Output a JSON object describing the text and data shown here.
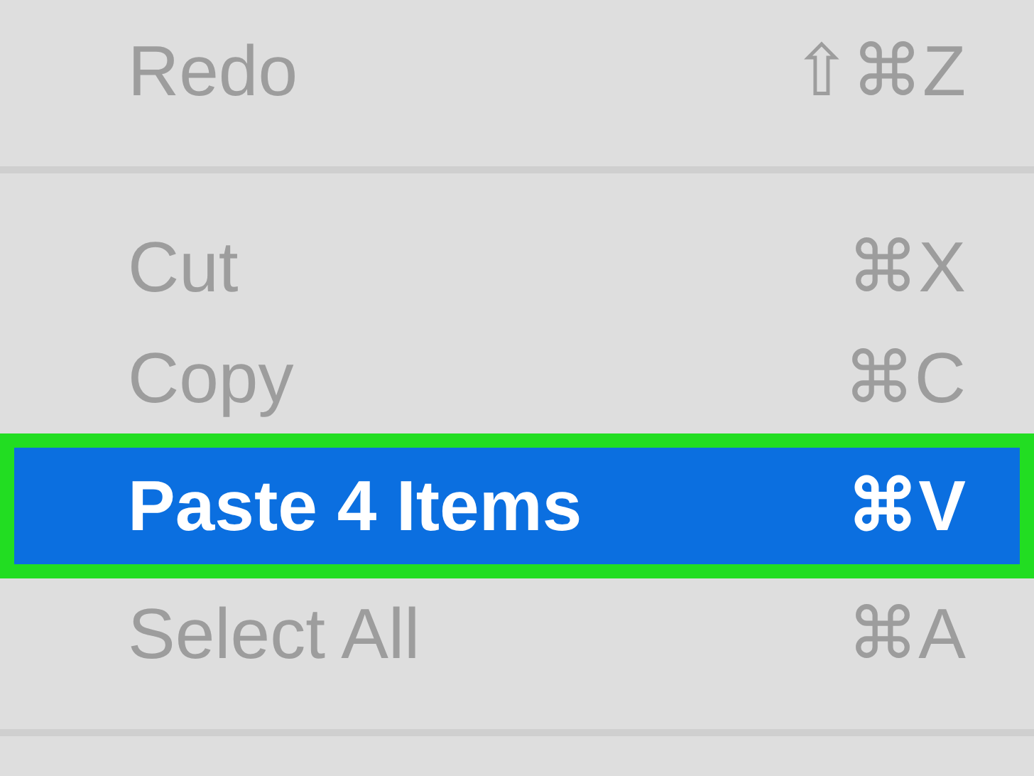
{
  "menu": {
    "items": [
      {
        "kind": "item",
        "label": "Redo",
        "shortcut": "⇧⌘Z",
        "disabled": true,
        "selected": false,
        "annotated": false
      },
      {
        "kind": "separator"
      },
      {
        "kind": "item",
        "label": "Cut",
        "shortcut": "⌘X",
        "disabled": true,
        "selected": false,
        "annotated": false
      },
      {
        "kind": "item",
        "label": "Copy",
        "shortcut": "⌘C",
        "disabled": true,
        "selected": false,
        "annotated": false
      },
      {
        "kind": "item",
        "label": "Paste 4 Items",
        "shortcut": "⌘V",
        "disabled": false,
        "selected": true,
        "annotated": true
      },
      {
        "kind": "item",
        "label": "Select All",
        "shortcut": "⌘A",
        "disabled": true,
        "selected": false,
        "annotated": false
      },
      {
        "kind": "separator"
      }
    ]
  }
}
